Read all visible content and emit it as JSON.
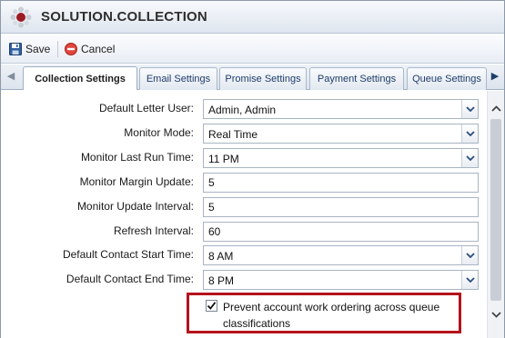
{
  "window": {
    "title": "SOLUTION.COLLECTION",
    "logo_icon": "app-logo-icon"
  },
  "toolbar": {
    "save_label": "Save",
    "save_icon": "floppy-disk-icon",
    "cancel_label": "Cancel",
    "cancel_icon": "no-entry-icon"
  },
  "tabs": [
    {
      "label": "Collection Settings",
      "active": true
    },
    {
      "label": "Email Settings",
      "active": false
    },
    {
      "label": "Promise Settings",
      "active": false
    },
    {
      "label": "Payment Settings",
      "active": false
    },
    {
      "label": "Queue Settings",
      "active": false
    }
  ],
  "form": {
    "default_letter_user": {
      "label": "Default Letter User:",
      "value": "Admin, Admin"
    },
    "monitor_mode": {
      "label": "Monitor Mode:",
      "value": "Real Time"
    },
    "monitor_last_run_time": {
      "label": "Monitor Last Run Time:",
      "value": "11 PM"
    },
    "monitor_margin_update": {
      "label": "Monitor Margin Update:",
      "value": "5"
    },
    "monitor_update_interval": {
      "label": "Monitor Update Interval:",
      "value": "5"
    },
    "refresh_interval": {
      "label": "Refresh Interval:",
      "value": "60"
    },
    "default_contact_start_time": {
      "label": "Default Contact Start Time:",
      "value": "8 AM"
    },
    "default_contact_end_time": {
      "label": "Default Contact End Time:",
      "value": "8 PM"
    },
    "prevent_account_work_ordering": {
      "label": "Prevent account work ordering across queue classifications",
      "checked": true
    }
  },
  "colors": {
    "highlight_border": "#b5121b",
    "tab_text": "#1f3d6b"
  }
}
